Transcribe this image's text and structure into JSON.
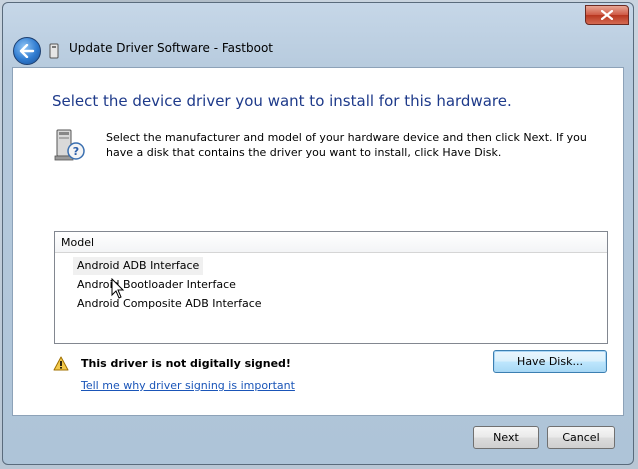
{
  "window": {
    "title": "Update Driver Software - Fastboot",
    "close_icon": "close-icon",
    "back_icon": "back-arrow-icon"
  },
  "content": {
    "heading": "Select the device driver you want to install for this hardware.",
    "instruction": "Select the manufacturer and model of your hardware device and then click Next. If you have a disk that contains the driver you want to install, click Have Disk."
  },
  "model_list": {
    "header": "Model",
    "items": [
      {
        "label": "Android ADB Interface",
        "selected": true
      },
      {
        "label": "Android Bootloader Interface",
        "selected": false
      },
      {
        "label": "Android Composite ADB Interface",
        "selected": false
      }
    ]
  },
  "warning": {
    "text": "This driver is not digitally signed!",
    "link": "Tell me why driver signing is important"
  },
  "buttons": {
    "have_disk": "Have Disk...",
    "next": "Next",
    "cancel": "Cancel"
  },
  "colors": {
    "heading": "#1e3a8a",
    "link": "#1a55b8",
    "selected_row": "#f0f0f0"
  }
}
